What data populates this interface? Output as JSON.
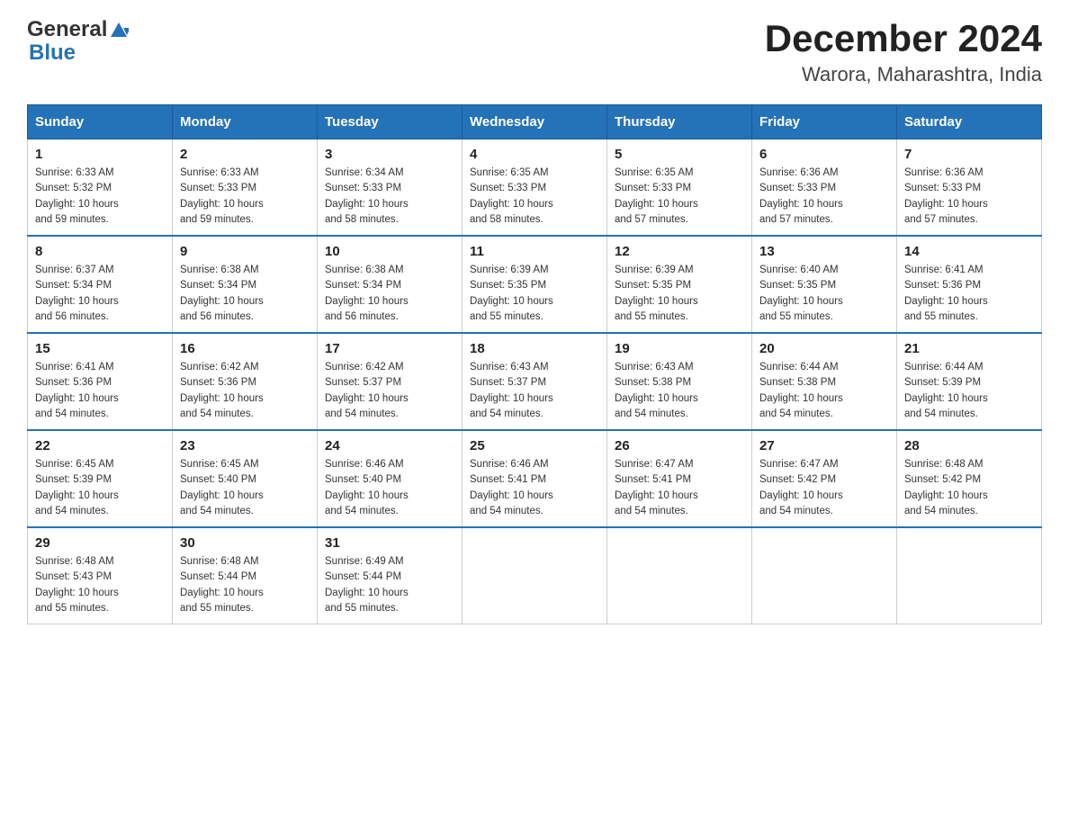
{
  "header": {
    "logo_general": "General",
    "logo_blue": "Blue",
    "month_title": "December 2024",
    "location": "Warora, Maharashtra, India"
  },
  "days_of_week": [
    "Sunday",
    "Monday",
    "Tuesday",
    "Wednesday",
    "Thursday",
    "Friday",
    "Saturday"
  ],
  "weeks": [
    [
      {
        "day": "1",
        "sunrise": "6:33 AM",
        "sunset": "5:32 PM",
        "daylight": "10 hours and 59 minutes."
      },
      {
        "day": "2",
        "sunrise": "6:33 AM",
        "sunset": "5:33 PM",
        "daylight": "10 hours and 59 minutes."
      },
      {
        "day": "3",
        "sunrise": "6:34 AM",
        "sunset": "5:33 PM",
        "daylight": "10 hours and 58 minutes."
      },
      {
        "day": "4",
        "sunrise": "6:35 AM",
        "sunset": "5:33 PM",
        "daylight": "10 hours and 58 minutes."
      },
      {
        "day": "5",
        "sunrise": "6:35 AM",
        "sunset": "5:33 PM",
        "daylight": "10 hours and 57 minutes."
      },
      {
        "day": "6",
        "sunrise": "6:36 AM",
        "sunset": "5:33 PM",
        "daylight": "10 hours and 57 minutes."
      },
      {
        "day": "7",
        "sunrise": "6:36 AM",
        "sunset": "5:33 PM",
        "daylight": "10 hours and 57 minutes."
      }
    ],
    [
      {
        "day": "8",
        "sunrise": "6:37 AM",
        "sunset": "5:34 PM",
        "daylight": "10 hours and 56 minutes."
      },
      {
        "day": "9",
        "sunrise": "6:38 AM",
        "sunset": "5:34 PM",
        "daylight": "10 hours and 56 minutes."
      },
      {
        "day": "10",
        "sunrise": "6:38 AM",
        "sunset": "5:34 PM",
        "daylight": "10 hours and 56 minutes."
      },
      {
        "day": "11",
        "sunrise": "6:39 AM",
        "sunset": "5:35 PM",
        "daylight": "10 hours and 55 minutes."
      },
      {
        "day": "12",
        "sunrise": "6:39 AM",
        "sunset": "5:35 PM",
        "daylight": "10 hours and 55 minutes."
      },
      {
        "day": "13",
        "sunrise": "6:40 AM",
        "sunset": "5:35 PM",
        "daylight": "10 hours and 55 minutes."
      },
      {
        "day": "14",
        "sunrise": "6:41 AM",
        "sunset": "5:36 PM",
        "daylight": "10 hours and 55 minutes."
      }
    ],
    [
      {
        "day": "15",
        "sunrise": "6:41 AM",
        "sunset": "5:36 PM",
        "daylight": "10 hours and 54 minutes."
      },
      {
        "day": "16",
        "sunrise": "6:42 AM",
        "sunset": "5:36 PM",
        "daylight": "10 hours and 54 minutes."
      },
      {
        "day": "17",
        "sunrise": "6:42 AM",
        "sunset": "5:37 PM",
        "daylight": "10 hours and 54 minutes."
      },
      {
        "day": "18",
        "sunrise": "6:43 AM",
        "sunset": "5:37 PM",
        "daylight": "10 hours and 54 minutes."
      },
      {
        "day": "19",
        "sunrise": "6:43 AM",
        "sunset": "5:38 PM",
        "daylight": "10 hours and 54 minutes."
      },
      {
        "day": "20",
        "sunrise": "6:44 AM",
        "sunset": "5:38 PM",
        "daylight": "10 hours and 54 minutes."
      },
      {
        "day": "21",
        "sunrise": "6:44 AM",
        "sunset": "5:39 PM",
        "daylight": "10 hours and 54 minutes."
      }
    ],
    [
      {
        "day": "22",
        "sunrise": "6:45 AM",
        "sunset": "5:39 PM",
        "daylight": "10 hours and 54 minutes."
      },
      {
        "day": "23",
        "sunrise": "6:45 AM",
        "sunset": "5:40 PM",
        "daylight": "10 hours and 54 minutes."
      },
      {
        "day": "24",
        "sunrise": "6:46 AM",
        "sunset": "5:40 PM",
        "daylight": "10 hours and 54 minutes."
      },
      {
        "day": "25",
        "sunrise": "6:46 AM",
        "sunset": "5:41 PM",
        "daylight": "10 hours and 54 minutes."
      },
      {
        "day": "26",
        "sunrise": "6:47 AM",
        "sunset": "5:41 PM",
        "daylight": "10 hours and 54 minutes."
      },
      {
        "day": "27",
        "sunrise": "6:47 AM",
        "sunset": "5:42 PM",
        "daylight": "10 hours and 54 minutes."
      },
      {
        "day": "28",
        "sunrise": "6:48 AM",
        "sunset": "5:42 PM",
        "daylight": "10 hours and 54 minutes."
      }
    ],
    [
      {
        "day": "29",
        "sunrise": "6:48 AM",
        "sunset": "5:43 PM",
        "daylight": "10 hours and 55 minutes."
      },
      {
        "day": "30",
        "sunrise": "6:48 AM",
        "sunset": "5:44 PM",
        "daylight": "10 hours and 55 minutes."
      },
      {
        "day": "31",
        "sunrise": "6:49 AM",
        "sunset": "5:44 PM",
        "daylight": "10 hours and 55 minutes."
      },
      null,
      null,
      null,
      null
    ]
  ],
  "labels": {
    "sunrise": "Sunrise:",
    "sunset": "Sunset:",
    "daylight": "Daylight:"
  }
}
